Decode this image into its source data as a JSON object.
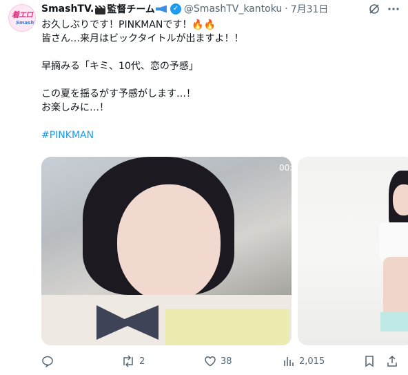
{
  "tweet": {
    "author": {
      "name": "SmashTV.",
      "name_suffix": "監督チーム",
      "handle": "@SmashTV_kantoku",
      "separator": "·",
      "date": "7月31日",
      "avatar_text": "着エロ",
      "avatar_subtext": "SmashTV"
    },
    "lines": [
      "お久しぶりです！PINKMANです！🔥🔥",
      "皆さん…来月はビックタイトルが出ますよ！！",
      "",
      "早摘みる「キミ、10代、恋の予感」",
      "",
      "この夏を揺るがす予感がします…！",
      "お楽しみに…！",
      "",
      "#PINKMAN"
    ],
    "hashtag": "#PINKMAN",
    "media": {
      "video_duration": "00:"
    },
    "stats": {
      "replies": "",
      "retweets": "2",
      "likes": "38",
      "views": "2,015"
    }
  },
  "colors": {
    "link": "#1d9bf0",
    "secondary": "#536471",
    "verified": "#1d9bf0"
  },
  "icons": [
    "clapperboard-icon",
    "megaphone-icon",
    "verified-icon",
    "grok-icon",
    "more-icon",
    "reply-icon",
    "retweet-icon",
    "like-icon",
    "views-icon",
    "bookmark-icon",
    "share-icon"
  ]
}
